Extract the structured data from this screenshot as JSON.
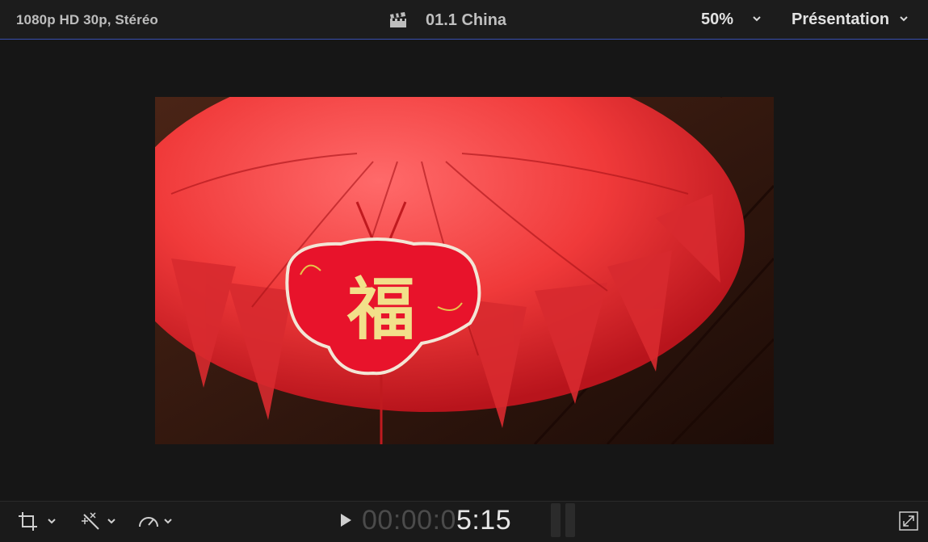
{
  "topbar": {
    "format": "1080p HD 30p, Stéréo",
    "clip_icon": "clapperboard-icon",
    "clip_title": "01.1 China",
    "zoom": "50%",
    "view_menu": "Présentation"
  },
  "viewer": {
    "content": "video-frame",
    "character": "福"
  },
  "bottombar": {
    "tools": [
      {
        "icon": "crop-icon"
      },
      {
        "icon": "magic-wand-icon"
      },
      {
        "icon": "speedometer-icon"
      }
    ],
    "timecode_dim": "00:00:0",
    "timecode_bright": "5:15",
    "fullscreen_icon": "fullscreen-icon"
  }
}
